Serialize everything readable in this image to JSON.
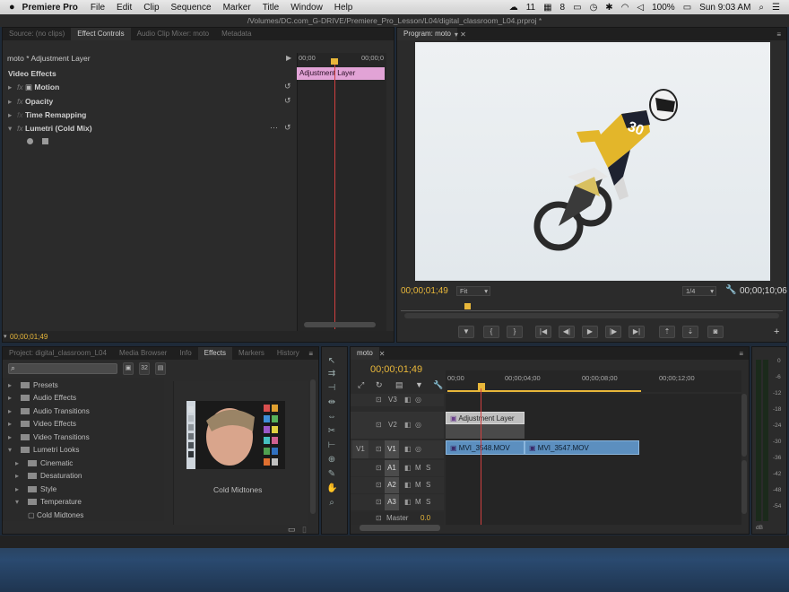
{
  "menubar": {
    "app": "Premiere Pro",
    "items": [
      "File",
      "Edit",
      "Clip",
      "Sequence",
      "Marker",
      "Title",
      "Window",
      "Help"
    ],
    "status_11": "11",
    "status_8": "8",
    "battery": "100%",
    "clock": "Sun 9:03 AM"
  },
  "window_title": "/Volumes/DC.com_G-DRIVE/Premiere_Pro_Lesson/L04/digital_classroom_L04.prproj *",
  "source_panel": {
    "tabs": [
      "Source: (no clips)",
      "Effect Controls",
      "Audio Clip Mixer: moto",
      "Metadata"
    ],
    "clip_name": "moto * Adjustment Layer",
    "time_start": "00;00",
    "time_end": "00;00;0",
    "clip_label": "Adjustment Layer",
    "section": "Video Effects",
    "effects": [
      "Motion",
      "Opacity",
      "Time Remapping",
      "Lumetri (Cold Mix)"
    ],
    "timecode": "00;00;01;49"
  },
  "program_panel": {
    "tab": "Program: moto",
    "timecode": "00;00;01;49",
    "fit": "Fit",
    "quality": "1/4",
    "duration": "00;00;10;06"
  },
  "project_panel": {
    "tabs": [
      "Project: digital_classroom_L04",
      "Media Browser",
      "Info",
      "Effects",
      "Markers",
      "History"
    ],
    "items": [
      "Presets",
      "Audio Effects",
      "Audio Transitions",
      "Video Effects",
      "Video Transitions",
      "Lumetri Looks",
      "Cinematic",
      "Desaturation",
      "Style",
      "Temperature",
      "Cold Midtones"
    ],
    "preview_label": "Cold Midtones"
  },
  "timeline": {
    "tab": "moto",
    "timecode": "00;00;01;49",
    "ruler": [
      "00;00",
      "00;00;04;00",
      "00;00;08;00",
      "00;00;12;00"
    ],
    "tracks": {
      "v3": "V3",
      "v2": "V2",
      "v1": "V1",
      "v1_src": "V1",
      "a1": "A1",
      "a2": "A2",
      "a3": "A3",
      "m": "M",
      "s": "S",
      "master": "Master",
      "master_val": "0.0"
    },
    "clips": {
      "adjustment": "Adjustment Layer",
      "clip1": "MVI_3548.MOV",
      "clip2": "MVI_3547.MOV"
    }
  },
  "meters": {
    "scale": [
      "0",
      "-6",
      "-12",
      "-18",
      "-24",
      "-30",
      "-36",
      "-42",
      "-48",
      "-54",
      "dB"
    ]
  },
  "colors": {
    "accent": "#e8b73a",
    "clip": "#5c8fbf",
    "adjustment": "#e2a3d6",
    "playhead": "#d04040"
  }
}
